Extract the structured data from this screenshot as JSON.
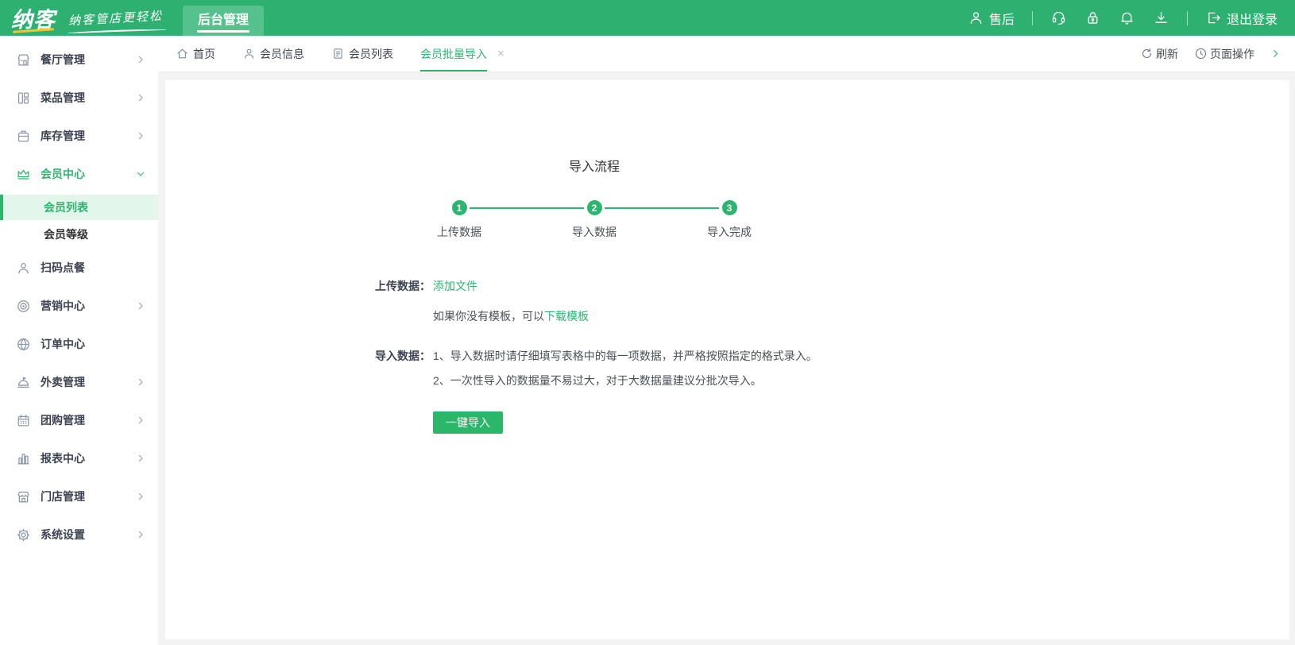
{
  "header": {
    "logo_text": "纳客",
    "slogan": "纳客管店更轻松",
    "nav_tab": "后台管理",
    "aftersale_label": "售后",
    "logout_label": "退出登录",
    "icons": [
      "user-icon",
      "headset-icon",
      "lock-icon",
      "bell-icon",
      "download-icon",
      "logout-icon"
    ]
  },
  "sidebar": {
    "items": [
      {
        "label": "餐厅管理",
        "icon": "restaurant-icon",
        "chevron": true
      },
      {
        "label": "菜品管理",
        "icon": "dishes-icon",
        "chevron": true
      },
      {
        "label": "库存管理",
        "icon": "inventory-icon",
        "chevron": true
      },
      {
        "label": "会员中心",
        "icon": "member-crown-icon",
        "chevron": "down",
        "expanded": true,
        "children": [
          {
            "label": "会员列表",
            "active": true
          },
          {
            "label": "会员等级",
            "active": false
          }
        ]
      },
      {
        "label": "扫码点餐",
        "icon": "scan-order-icon",
        "chevron": false
      },
      {
        "label": "营销中心",
        "icon": "marketing-icon",
        "chevron": true
      },
      {
        "label": "订单中心",
        "icon": "order-globe-icon",
        "chevron": false
      },
      {
        "label": "外卖管理",
        "icon": "takeout-icon",
        "chevron": true
      },
      {
        "label": "团购管理",
        "icon": "groupbuy-icon",
        "chevron": true
      },
      {
        "label": "报表中心",
        "icon": "report-icon",
        "chevron": true
      },
      {
        "label": "门店管理",
        "icon": "store-icon",
        "chevron": true
      },
      {
        "label": "系统设置",
        "icon": "settings-icon",
        "chevron": true
      }
    ]
  },
  "tabbar": {
    "tabs": [
      {
        "label": "首页",
        "icon": "home-icon",
        "active": false
      },
      {
        "label": "会员信息",
        "icon": "user-icon",
        "active": false
      },
      {
        "label": "会员列表",
        "icon": "document-icon",
        "active": false
      },
      {
        "label": "会员批量导入",
        "icon": null,
        "active": true,
        "closable": true
      }
    ],
    "close_glyph": "×",
    "refresh_label": "刷新",
    "page_actions_label": "页面操作"
  },
  "main": {
    "flow_title": "导入流程",
    "steps": [
      {
        "num": "1",
        "label": "上传数据"
      },
      {
        "num": "2",
        "label": "导入数据"
      },
      {
        "num": "3",
        "label": "导入完成"
      }
    ],
    "upload": {
      "label": "上传数据：",
      "add_file_link": "添加文件",
      "hint_prefix": "如果你没有模板，可以",
      "template_link": "下载模板"
    },
    "import": {
      "label": "导入数据：",
      "line1": "1、导入数据时请仔细填写表格中的每一项数据，并严格按照指定的格式录入。",
      "line2": "2、一次性导入的数据量不易过大，对于大数据量建议分批次导入。"
    },
    "import_button": "一键导入"
  },
  "colors": {
    "header_green": "#2eb170",
    "header_tab_green": "#55c28d",
    "accent_green": "#2cb56f",
    "active_item_bg": "#e2f6ec",
    "logo_accent_yellow": "#f5c432",
    "page_bg": "#f2f3f2"
  }
}
